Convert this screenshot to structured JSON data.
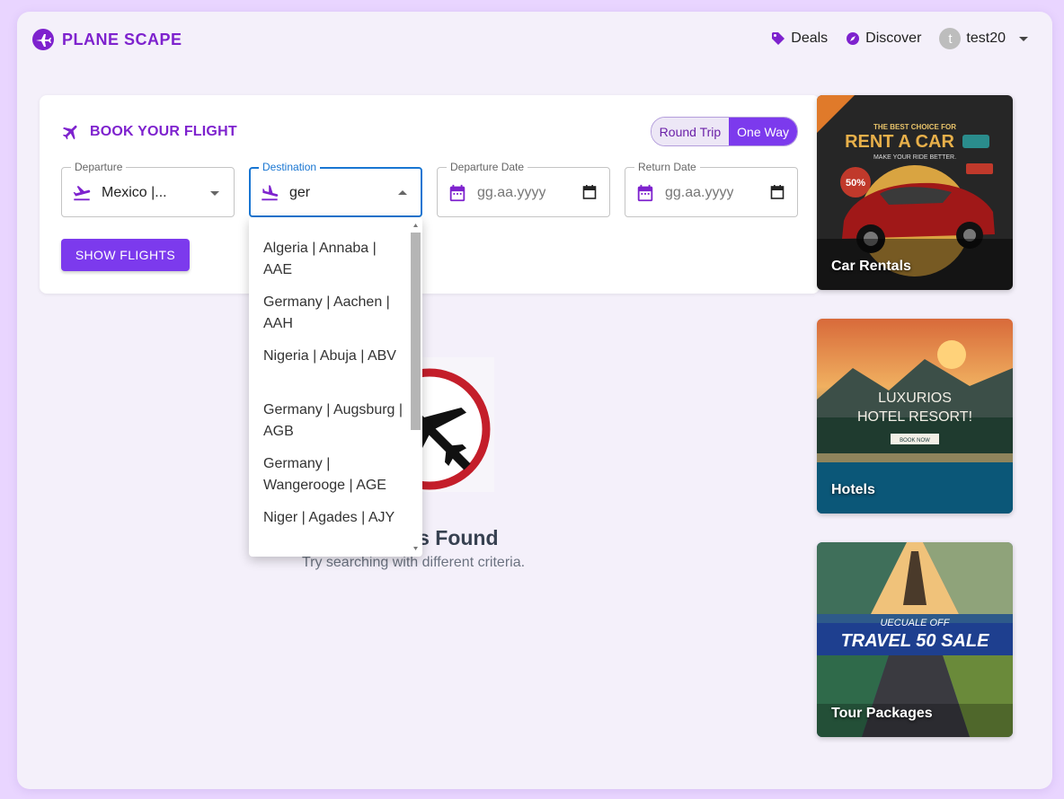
{
  "header": {
    "brand": "PLANE SCAPE",
    "nav": {
      "deals": "Deals",
      "discover": "Discover",
      "user_initial": "t",
      "username": "test20"
    }
  },
  "booking": {
    "title": "BOOK YOUR FLIGHT",
    "trip_types": [
      "Round Trip",
      "One Way"
    ],
    "selected_trip_type": "One Way",
    "departure": {
      "label": "Departure",
      "value": "Mexico |..."
    },
    "destination": {
      "label": "Destination",
      "value": "ger"
    },
    "departure_date": {
      "label": "Departure Date",
      "placeholder": "gg.aa.yyyy"
    },
    "return_date": {
      "label": "Return Date",
      "placeholder": "gg.aa.yyyy"
    },
    "show_button": "SHOW FLIGHTS"
  },
  "destination_options": [
    "Algeria | Annaba | AAE",
    "Germany | Aachen | AAH",
    "Nigeria | Abuja | ABV",
    "Germany | Augsburg | AGB",
    "Germany | Wangerooge | AGE",
    "Niger | Agades | AJY"
  ],
  "empty_state": {
    "title": "No Flights Found",
    "subtitle": "Try searching with different criteria."
  },
  "promos": {
    "car": {
      "label": "Car Rentals",
      "image_text": {
        "choice": "THE BEST CHOICE FOR",
        "headline": "RENT A CAR",
        "tagline": "MAKE YOUR RIDE BETTER.",
        "discount": "50%"
      }
    },
    "hotel": {
      "label": "Hotels",
      "image_text": {
        "line1": "LUXURIOS",
        "line2": "HOTEL RESORT!",
        "cta": "BOOK NOW"
      }
    },
    "tour": {
      "label": "Tour Packages",
      "image_text": {
        "line1": "UECUALE OFF",
        "line2": "TRAVEL 50 SALE"
      }
    }
  },
  "colors": {
    "brand": "#7e22ce",
    "accent": "#7c3aed",
    "focus": "#1976d2"
  },
  "icons": {
    "brand": "airplane-circle-icon",
    "deals": "tag-icon",
    "discover": "compass-icon",
    "departure": "flight-takeoff-icon",
    "destination": "flight-land-icon",
    "date": "calendar-icon"
  }
}
